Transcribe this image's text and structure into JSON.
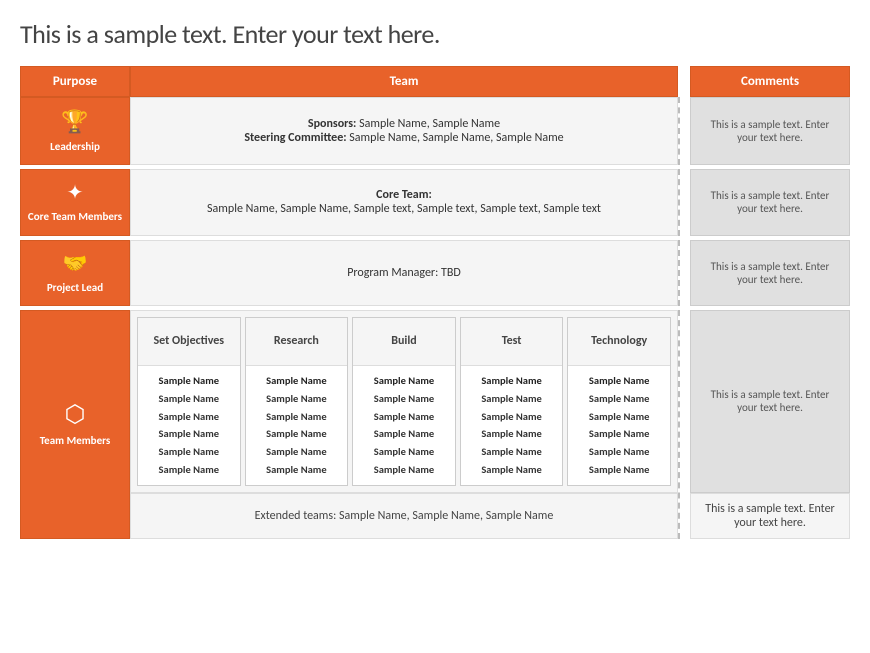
{
  "page": {
    "title": "This is a sample text. Enter your text here."
  },
  "header": {
    "purpose_label": "Purpose",
    "team_label": "Team",
    "comments_label": "Comments"
  },
  "rows": {
    "leadership": {
      "purpose_label": "Leadership",
      "icon": "🏆",
      "sponsors_label": "Sponsors:",
      "sponsors_value": "Sample Name, Sample Name",
      "committee_label": "Steering Committee:",
      "committee_value": "Sample Name, Sample Name, Sample Name",
      "comment": "This is a sample text. Enter your text here."
    },
    "core_team": {
      "purpose_label": "Core Team Members",
      "icon": "✦",
      "core_label": "Core Team:",
      "core_value": "Sample Name, Sample Name, Sample text, Sample text, Sample text, Sample text",
      "comment": "This is a sample text. Enter your text here."
    },
    "project_lead": {
      "purpose_label": "Project Lead",
      "icon": "🤝",
      "team_text": "Program Manager: TBD",
      "comment": "This is a sample text. Enter your text here."
    },
    "team_members": {
      "purpose_label": "Team Members",
      "icon": "⬡",
      "sub_columns": [
        {
          "header": "Set Objectives",
          "names": [
            "Sample Name",
            "Sample Name",
            "Sample Name",
            "Sample Name",
            "Sample Name",
            "Sample Name"
          ]
        },
        {
          "header": "Research",
          "names": [
            "Sample Name",
            "Sample Name",
            "Sample Name",
            "Sample Name",
            "Sample Name",
            "Sample Name"
          ]
        },
        {
          "header": "Build",
          "names": [
            "Sample Name",
            "Sample Name",
            "Sample Name",
            "Sample Name",
            "Sample Name",
            "Sample Name"
          ]
        },
        {
          "header": "Test",
          "names": [
            "Sample Name",
            "Sample Name",
            "Sample Name",
            "Sample Name",
            "Sample Name",
            "Sample Name"
          ]
        },
        {
          "header": "Technology",
          "names": [
            "Sample Name",
            "Sample Name",
            "Sample Name",
            "Sample Name",
            "Sample Name",
            "Sample Name"
          ]
        }
      ],
      "comment": "This is a sample text. Enter your text here.",
      "extended_comment": "This is a sample text. Enter your text here.",
      "extended_text": "Extended teams: Sample Name, Sample Name, Sample Name"
    }
  }
}
